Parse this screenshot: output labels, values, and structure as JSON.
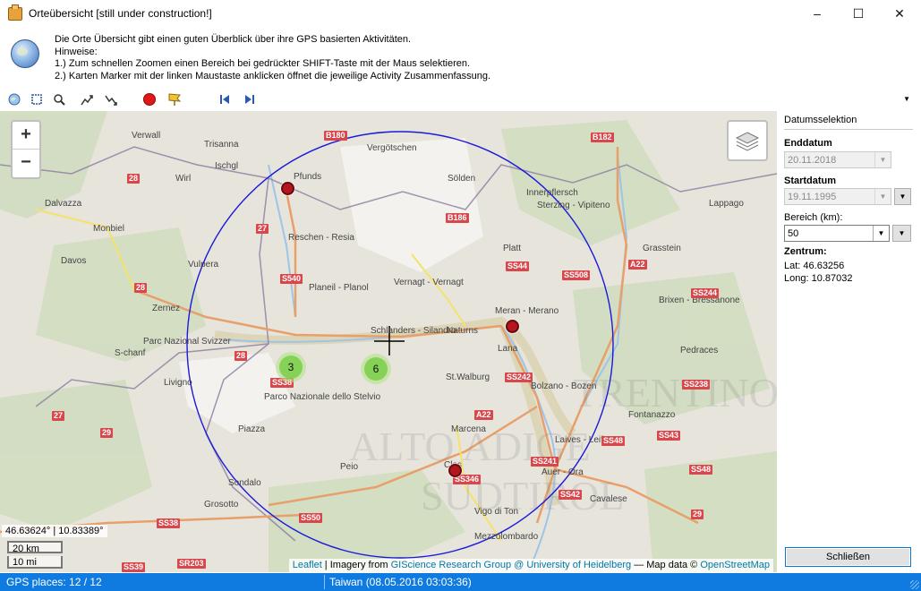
{
  "window": {
    "title": "Orteübersicht [still under construction!]",
    "minimize_glyph": "–",
    "maximize_glyph": "☐",
    "close_glyph": "✕"
  },
  "info": {
    "line1": "Die Orte Übersicht gibt einen guten Überblick über ihre GPS basierten Aktivitäten.",
    "line2": "Hinweise:",
    "line3": "1.) Zum schnellen Zoomen einen Bereich bei gedrückter SHIFT-Taste mit der Maus selektieren.",
    "line4": "2.) Karten Marker mit der linken Maustaste anklicken öffnet die jeweilige Activity Zusammenfassung."
  },
  "toolbar": {
    "icons": [
      "globe-icon",
      "select-area-icon",
      "zoom-icon",
      "route-up-icon",
      "route-down-icon",
      "record-icon",
      "flag-icon",
      "first-icon",
      "last-icon"
    ]
  },
  "map": {
    "zoom_in": "+",
    "zoom_out": "−",
    "coords": "46.63624° | 10.83389°",
    "scale_km": "20 km",
    "scale_mi": "10 mi",
    "attribution": {
      "leaflet": "Leaflet",
      "imagery_prefix": " | Imagery from ",
      "gisci": "GIScience Research Group @ University of Heidelberg",
      "mapdata": " — Map data © ",
      "osm": "OpenStreetMap"
    },
    "clusters": [
      {
        "count": "3"
      },
      {
        "count": "6"
      }
    ],
    "places": [
      "Verwall",
      "Trisanna",
      "Ischgl",
      "Wirl",
      "Pfunds",
      "Vergötschen",
      "Sölden",
      "Dalvazza",
      "Monbiel",
      "Reschen - Resia",
      "Davos",
      "Vulpera",
      "Planeil - Planol",
      "Vernagt - Vernagt",
      "Innerpflersch",
      "Sterzing - Vipiteno",
      "Lappago",
      "Grasstein",
      "Platt",
      "Meran - Merano",
      "Brixen - Bressanone",
      "Zernez",
      "Parc Nazional Svizzer",
      "S-chanf",
      "Schlanders - Silandro",
      "Naturns",
      "Lana",
      "Pedraces",
      "Livigno",
      "Parco Nazionale dello Stelvio",
      "St.Walburg",
      "Bolzano - Bozen",
      "Marcena",
      "Fontanazzo",
      "Piazza",
      "Laives - Leifers",
      "Cles",
      "Auer - Ora",
      "Cavalese",
      "Peio",
      "Sondalo",
      "Grosotto",
      "Vigo di Ton",
      "Mezzolombardo",
      "Cavalese",
      "Cles",
      "Cles"
    ],
    "roads": [
      "B180",
      "B182",
      "B186",
      "28",
      "27",
      "28",
      "S540",
      "SS44",
      "SS508",
      "A22",
      "SS244",
      "28",
      "27",
      "SS38",
      "SS242",
      "SS238",
      "A22",
      "SS241",
      "SS48",
      "SS43",
      "SS346",
      "SS48",
      "SS42",
      "SS50",
      "29",
      "29",
      "SS38",
      "SS39",
      "SR203"
    ],
    "watermark": "TRENTINO ALTO ADIGE SÜDTIROL",
    "colors": {
      "circle": "#1a1adb",
      "marker": "#b3161c",
      "cluster": "#6ecc39"
    }
  },
  "panel": {
    "header": "Datumsselektion",
    "end_label": "Enddatum",
    "end_value": "20.11.2018",
    "start_label": "Startdatum",
    "start_value": "19.11.1995",
    "range_label": "Bereich (km):",
    "range_value": "50",
    "center_label": "Zentrum:",
    "lat": "Lat: 46.63256",
    "long": "Long: 10.87032",
    "close_button": "Schließen"
  },
  "status": {
    "places": "GPS places: 12 / 12",
    "selection": "Taiwan (08.05.2016 03:03:36)"
  }
}
